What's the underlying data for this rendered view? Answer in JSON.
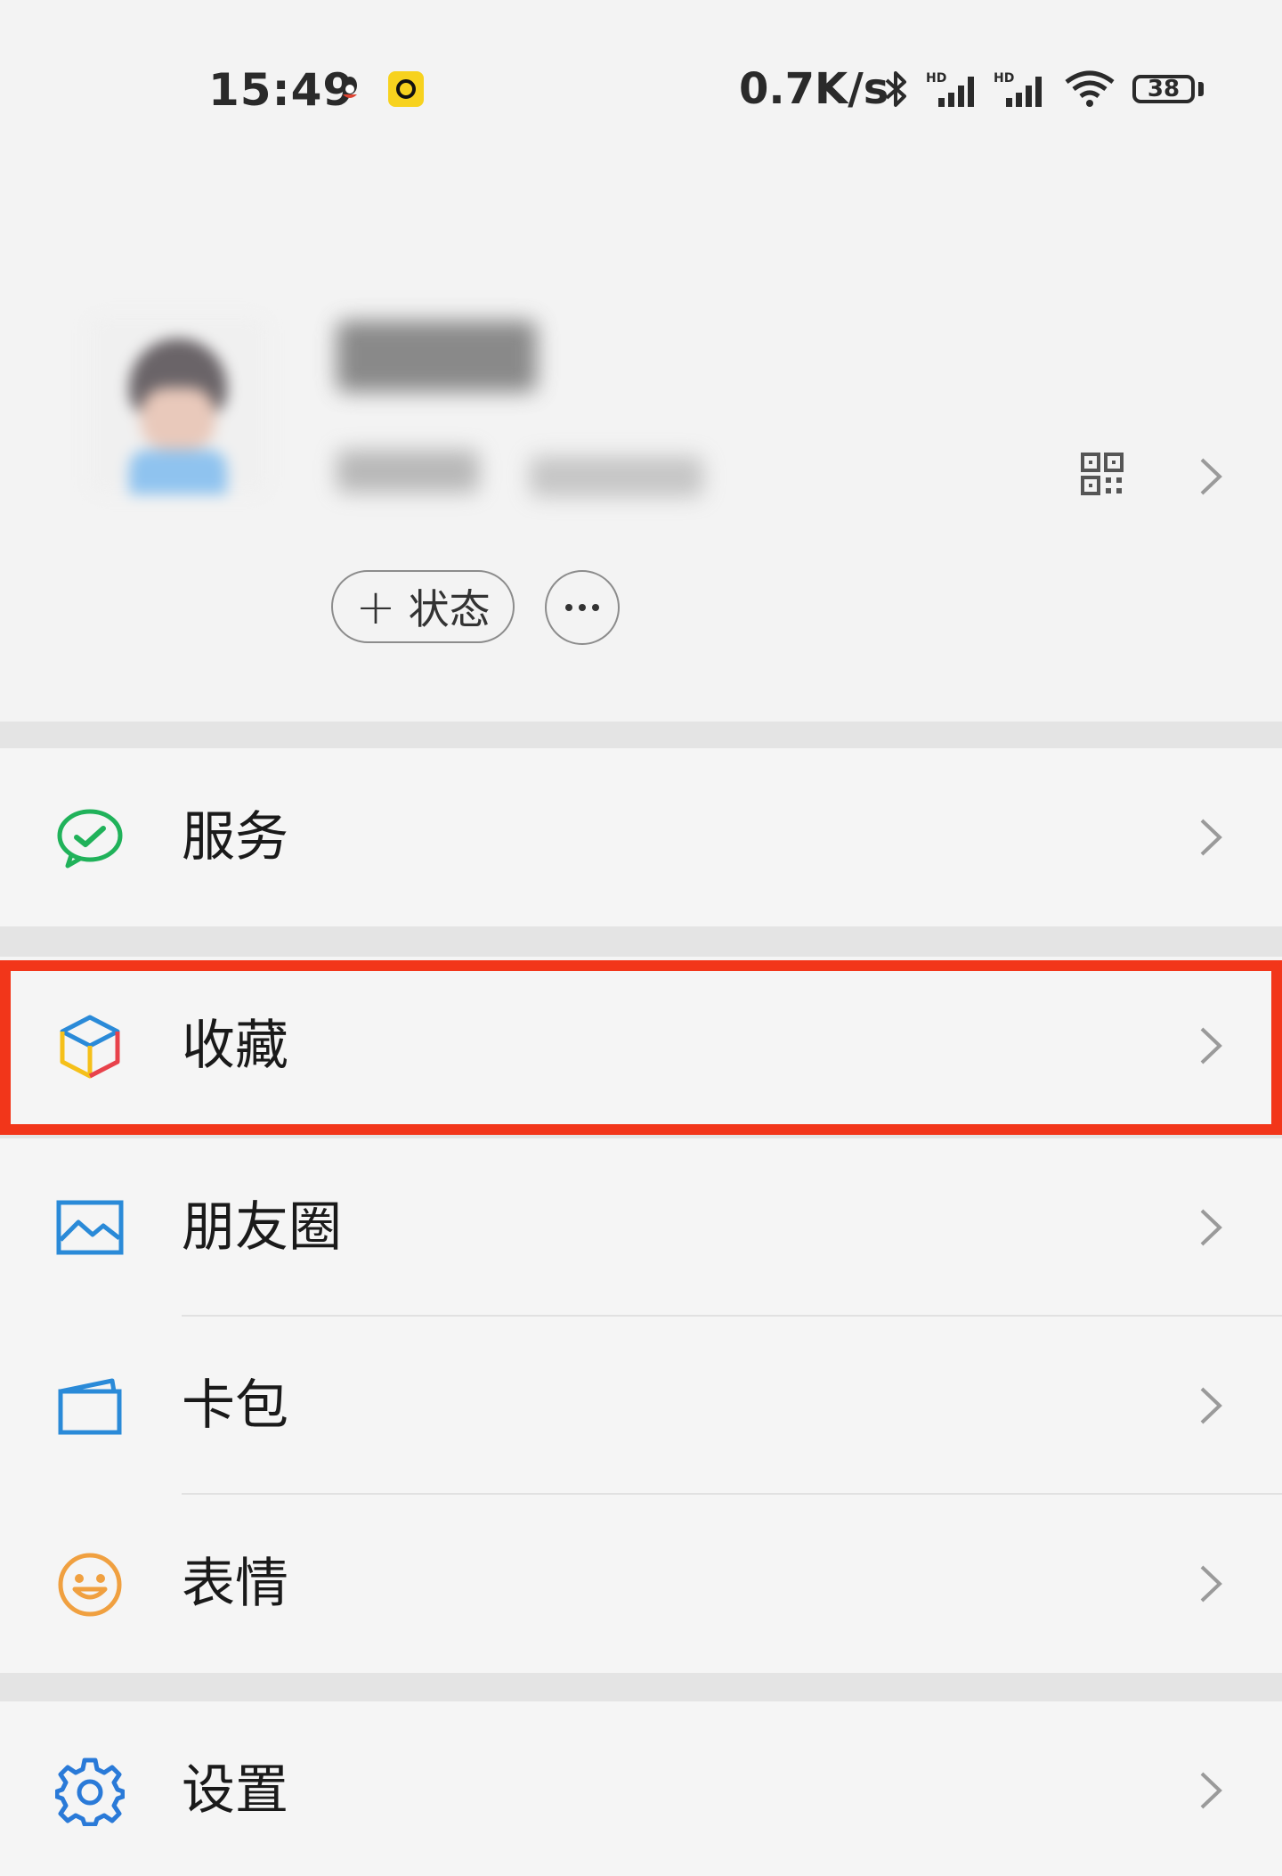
{
  "status_bar": {
    "time": "15:49",
    "net_speed": "0.7K/s",
    "battery": "38",
    "icons": [
      "qq-icon",
      "app-badge-icon",
      "bluetooth-icon",
      "signal-hd-icon",
      "signal-hd-icon",
      "wifi-icon",
      "battery-icon"
    ]
  },
  "profile": {
    "status_button": "+ 状态",
    "status_button_text": "状态",
    "more_button": "···"
  },
  "menu": {
    "services": "服务",
    "favorites": "收藏",
    "moments": "朋友圈",
    "cards": "卡包",
    "stickers": "表情",
    "settings": "设置"
  },
  "colors": {
    "highlight": "#f2361a",
    "services_icon": "#20b25a",
    "moments_icon": "#2a8ad8",
    "cards_icon": "#2a8ad8",
    "stickers_icon": "#f0a040",
    "settings_icon": "#2a7ad8"
  }
}
